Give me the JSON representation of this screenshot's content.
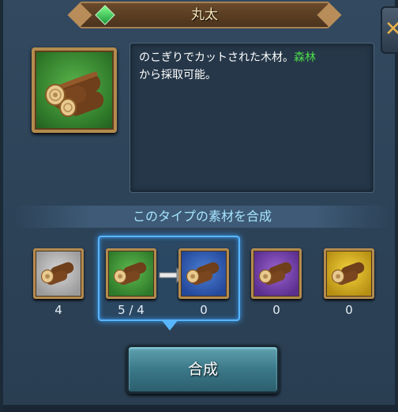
{
  "title": "丸太",
  "description": {
    "text_before": "のこぎりでカットされた木材。",
    "highlight": "森林",
    "text_after": "から採取可能。",
    "highlight_color": "#4cd94c"
  },
  "section_header": "このタイプの素材を合成",
  "slots": [
    {
      "tier": "gray",
      "count": "4"
    },
    {
      "tier": "green",
      "count": "5 / 4"
    },
    {
      "tier": "blue",
      "count": "0"
    },
    {
      "tier": "purple",
      "count": "0"
    },
    {
      "tier": "yellow",
      "count": "0"
    }
  ],
  "craft_button": "合成",
  "close_icon": "close-icon",
  "colors": {
    "title_text": "#f6e6b8",
    "section_text": "#a6e4ff",
    "selection_frame": "#58b6ff",
    "button": "#3b7888"
  }
}
